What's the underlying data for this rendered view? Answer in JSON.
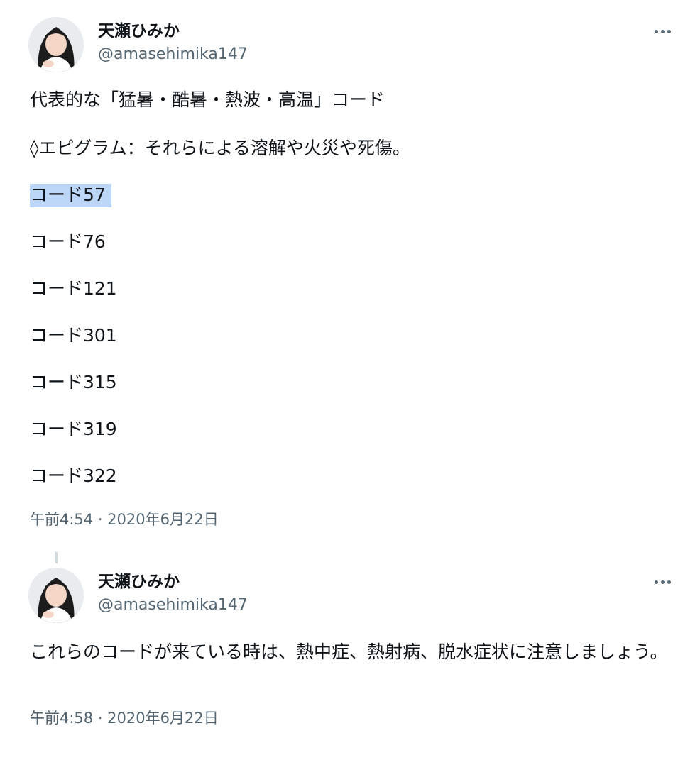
{
  "tweet1": {
    "display_name": "天瀬ひみか",
    "handle": "@amasehimika147",
    "lines": [
      "代表的な「猛暑・酷暑・熱波・高温」コード",
      "◊エピグラム：それらによる溶解や火災や死傷。",
      "コード57",
      "コード76",
      "コード121",
      "コード301",
      "コード315",
      "コード319",
      "コード322"
    ],
    "timestamp": "午前4:54 · 2020年6月22日"
  },
  "tweet2": {
    "display_name": "天瀬ひみか",
    "handle": "@amasehimika147",
    "text": "これらのコードが来ている時は、熱中症、熱射病、脱水症状に注意しましょう。",
    "timestamp": "午前4:58 · 2020年6月22日"
  },
  "colors": {
    "text_primary": "#0f1419",
    "text_secondary": "#536471",
    "selection_highlight": "#bcd6f7"
  },
  "icons": {
    "more": "more-horizontal-icon"
  }
}
